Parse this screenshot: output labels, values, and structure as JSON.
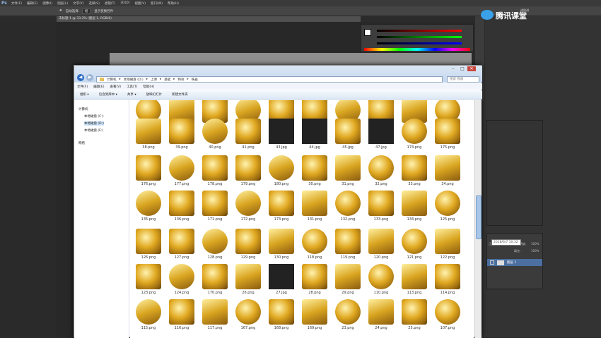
{
  "ps": {
    "logo": "Ps",
    "menu": [
      "文件(F)",
      "编辑(E)",
      "图像(I)",
      "图层(L)",
      "文字(Y)",
      "选择(S)",
      "滤镜(T)",
      "3D(D)",
      "视图(V)",
      "窗口(W)",
      "帮助(H)"
    ],
    "options": {
      "tool": "✥",
      "autoselect": "自动选择",
      "group": "组",
      "transform": "显示变换控件",
      "doc_tab": "未标题-1 @ 33.3% (图层 1, RGB/8)"
    },
    "layers": {
      "layer_name": "图层 1",
      "opacity_label": "不透明度:",
      "opacity": "100%",
      "fill_label": "填充:",
      "fill": "100%",
      "mode": "正常"
    }
  },
  "brand": {
    "name": "腾讯课堂",
    "sub": "进阶讲"
  },
  "explorer": {
    "back": "◀",
    "forward": "▶",
    "breadcrumb": [
      "计算机",
      "本地磁盘 (D:)",
      "上课",
      "基础",
      "特效",
      "铁器"
    ],
    "search_placeholder": "搜索 铁器",
    "menu": [
      "文件(F)",
      "编辑(E)",
      "查看(V)",
      "工具(T)",
      "帮助(H)"
    ],
    "commands": [
      "组织 ▾",
      "包含到库中 ▾",
      "共享 ▾",
      "放映幻灯片",
      "新建文件夹"
    ],
    "nav": {
      "computer": "计算机",
      "c": "本地磁盘 (C:)",
      "d": "本地磁盘 (D:)",
      "e": "本地磁盘 (E:)",
      "network": "网络"
    },
    "tooltip": "2018/6/7 10:32",
    "files": [
      [
        "62.png",
        "63.jpg",
        "181.png",
        "182.png",
        "183.png",
        "184.png",
        "185.png",
        "35.png",
        "36.png",
        "37.jpg"
      ],
      [
        "38.png",
        "39.png",
        "40.png",
        "41.png",
        "43.jpg",
        "44.jpg",
        "45.jpg",
        "47.jpg",
        "174.png",
        "175.png"
      ],
      [
        "176.png",
        "177.png",
        "178.png",
        "179.png",
        "180.png",
        "30.png",
        "31.png",
        "32.png",
        "33.png",
        "34.png"
      ],
      [
        "135.png",
        "136.png",
        "171.png",
        "172.png",
        "173.png",
        "131.png",
        "132.png",
        "133.png",
        "134.png",
        "125.png"
      ],
      [
        "126.png",
        "127.png",
        "128.png",
        "129.png",
        "130.png",
        "118.png",
        "119.png",
        "120.png",
        "121.png",
        "122.png"
      ],
      [
        "123.png",
        "124.png",
        "170.png",
        "26.png",
        "27.jpg",
        "28.png",
        "29.png",
        "110.png",
        "113.png",
        "114.png"
      ],
      [
        "115.png",
        "116.png",
        "117.png",
        "167.png",
        "168.png",
        "169.png",
        "23.png",
        "24.png",
        "25.png",
        "107.png"
      ]
    ]
  }
}
